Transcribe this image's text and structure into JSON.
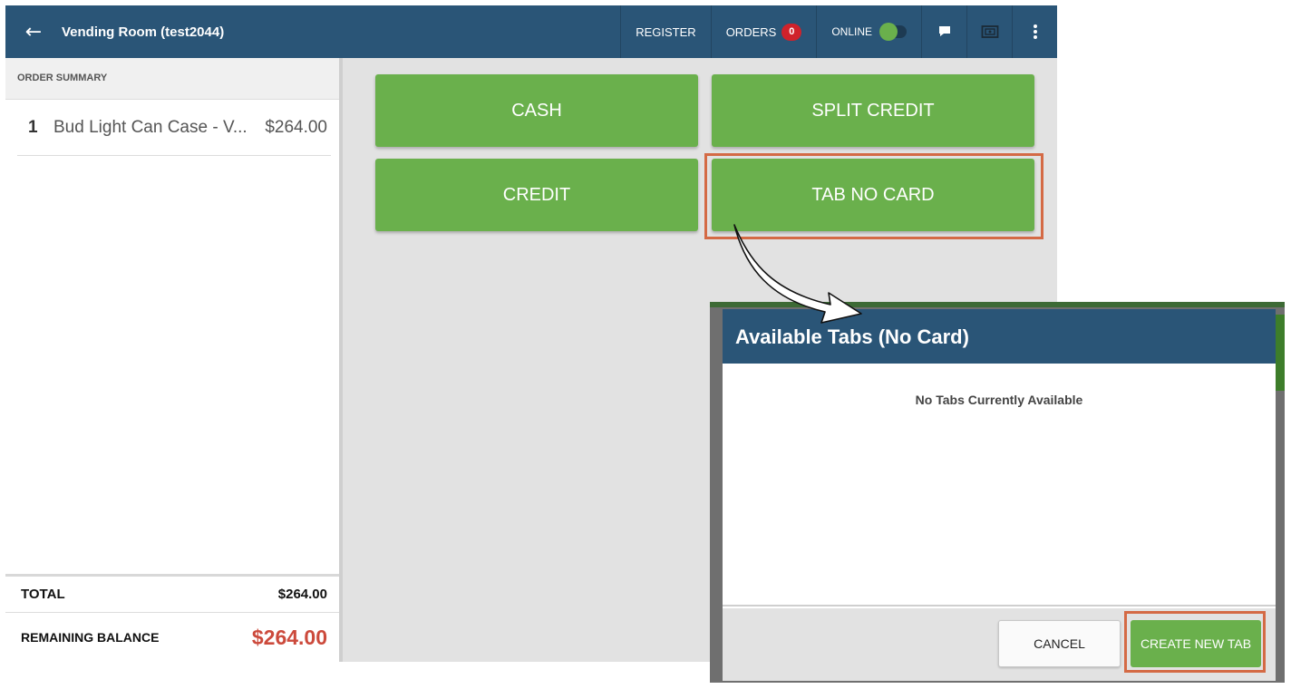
{
  "topbar": {
    "title": "Vending Room (test2044)",
    "register_label": "REGISTER",
    "orders_label": "ORDERS",
    "orders_count": "0",
    "online_label": "ONLINE",
    "online_enabled": true
  },
  "icons": {
    "back": "back-arrow-icon",
    "chat": "chat-icon",
    "cash_drawer": "cash-drawer-icon",
    "more": "more-vertical-icon"
  },
  "summary": {
    "header": "ORDER SUMMARY",
    "items": [
      {
        "qty": "1",
        "name": "Bud Light Can Case - V...",
        "price": "$264.00"
      }
    ],
    "total_label": "TOTAL",
    "total_value": "$264.00",
    "remaining_label": "REMAINING BALANCE",
    "remaining_value": "$264.00"
  },
  "payments": {
    "cash": "CASH",
    "split_credit": "SPLIT CREDIT",
    "credit": "CREDIT",
    "tab_no_card": "TAB NO CARD"
  },
  "dialog": {
    "title": "Available Tabs (No Card)",
    "empty_message": "No Tabs Currently Available",
    "cancel_label": "CANCEL",
    "create_label": "CREATE NEW TAB"
  },
  "colors": {
    "header": "#2a5577",
    "button_green": "#6ab04c",
    "badge_red": "#d0222b",
    "balance_red": "#cc4a3c",
    "highlight": "#d46a45"
  }
}
